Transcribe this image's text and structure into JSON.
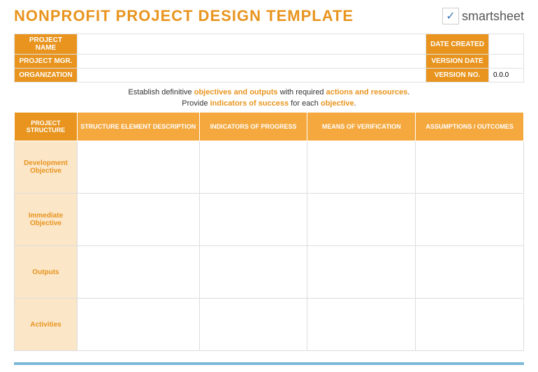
{
  "title": "NONPROFIT PROJECT DESIGN TEMPLATE",
  "brand": "smartsheet",
  "meta": {
    "left_labels": [
      "PROJECT NAME",
      "PROJECT MGR.",
      "ORGANIZATION"
    ],
    "right_labels": [
      "DATE CREATED",
      "VERSION DATE",
      "VERSION NO."
    ],
    "left_values": [
      "",
      "",
      ""
    ],
    "right_values": [
      "",
      "",
      "0.0.0"
    ]
  },
  "instr": {
    "line1_a": "Establish definitive ",
    "line1_b": "objectives and outputs",
    "line1_c": " with required ",
    "line1_d": "actions and resources",
    "line1_e": ".",
    "line2_a": "Provide ",
    "line2_b": "indicators of success",
    "line2_c": " for each ",
    "line2_d": "objective",
    "line2_e": "."
  },
  "headers": [
    "PROJECT STRUCTURE",
    "STRUCTURE ELEMENT DESCRIPTION",
    "INDICATORS OF PROGRESS",
    "MEANS OF VERIFICATION",
    "ASSUMPTIONS / OUTCOMES"
  ],
  "rows": [
    {
      "label": "Development Objective",
      "cells": [
        "",
        "",
        "",
        ""
      ]
    },
    {
      "label": "Immediate Objective",
      "cells": [
        "",
        "",
        "",
        ""
      ]
    },
    {
      "label": "Outputs",
      "cells": [
        "",
        "",
        "",
        ""
      ]
    },
    {
      "label": "Activities",
      "cells": [
        "",
        "",
        "",
        ""
      ]
    }
  ]
}
